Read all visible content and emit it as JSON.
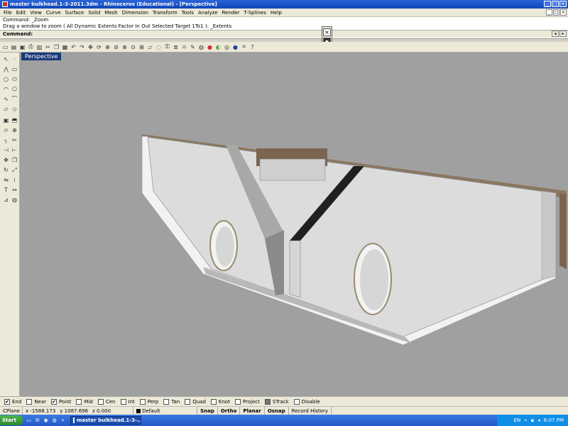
{
  "window": {
    "title": "master bulkhead.1-3-2011.3dm - Rhinoceros (Educational) - [Perspective]",
    "minimize": "_",
    "maximize": "□",
    "close": "×"
  },
  "menu": {
    "items": [
      "File",
      "Edit",
      "View",
      "Curve",
      "Surface",
      "Solid",
      "Mesh",
      "Dimension",
      "Transform",
      "Tools",
      "Analyze",
      "Render",
      "T-Splines",
      "Help"
    ]
  },
  "command": {
    "history_line1": "Command: _Zoom",
    "history_line2": "Drag a window to zoom ( All  Dynamic  Extents  Factor  In  Out  Selected  Target  1To1 ):  _Extents",
    "prompt": "Command:"
  },
  "viewport": {
    "label": "Perspective"
  },
  "icons": {
    "toolbar": [
      "new-icon",
      "open-icon",
      "save-icon",
      "print-icon",
      "import-icon",
      "cut-icon",
      "copy-icon",
      "paste-icon",
      "undo-icon",
      "redo-icon",
      "pan-icon",
      "rotate-icon",
      "zoom-dynamic-icon",
      "zoom-window-icon",
      "zoom-extents-icon",
      "zoom-selected-icon",
      "four-views-icon",
      "cplane-icon",
      "hide-icon",
      "lock-icon",
      "layers-icon",
      "light-icon",
      "properties-icon",
      "render-icon",
      "color-icon",
      "material-icon",
      "display-icon",
      "sphere-render-icon",
      "grid-icon",
      "help-icon"
    ],
    "sidebar": [
      "select-icon",
      "point-icon",
      "polyline-icon",
      "rectangle-icon",
      "circle-icon",
      "ellipse-icon",
      "arc-icon",
      "polygon-icon",
      "curve-icon",
      "freeform-icon",
      "surface-icon",
      "loft-icon",
      "box-icon",
      "extrude-icon",
      "cylinder-icon",
      "boolean-icon",
      "fillet-icon",
      "trim-icon",
      "split-icon",
      "join-icon",
      "move-icon",
      "copy-icon",
      "rotate-icon",
      "scale-icon",
      "mirror-icon",
      "array-icon",
      "text-icon",
      "dimension-icon",
      "analyze-icon",
      "render-icon"
    ]
  },
  "osnap": [
    {
      "label": "End",
      "checked": true
    },
    {
      "label": "Near",
      "checked": false
    },
    {
      "label": "Point",
      "checked": true
    },
    {
      "label": "Mid",
      "checked": false
    },
    {
      "label": "Cen",
      "checked": false
    },
    {
      "label": "Int",
      "checked": false
    },
    {
      "label": "Perp",
      "checked": false
    },
    {
      "label": "Tan",
      "checked": false
    },
    {
      "label": "Quad",
      "checked": false
    },
    {
      "label": "Knot",
      "checked": false
    },
    {
      "label": "Project",
      "checked": false
    },
    {
      "label": "STrack",
      "checked": true
    },
    {
      "label": "Disable",
      "checked": false
    }
  ],
  "status": {
    "cplane": "CPlane",
    "x": "x -1588.173",
    "y": "y 1087.696",
    "z": "z 0.000",
    "layer": "Default",
    "snap": "Snap",
    "ortho": "Ortho",
    "planar": "Planar",
    "osnap": "Osnap",
    "record": "Record History"
  },
  "taskbar": {
    "start": "Start",
    "task": "master bulkhead.1-3-...",
    "lang": "EN",
    "clock": "6:07 PM"
  },
  "colors": {
    "viewport_bg": "#a0a0a0",
    "part_light": "#e0e0e0",
    "part_mid": "#c8c8c8",
    "part_shadow": "#8a8a8a",
    "wood": "#8b7660"
  }
}
